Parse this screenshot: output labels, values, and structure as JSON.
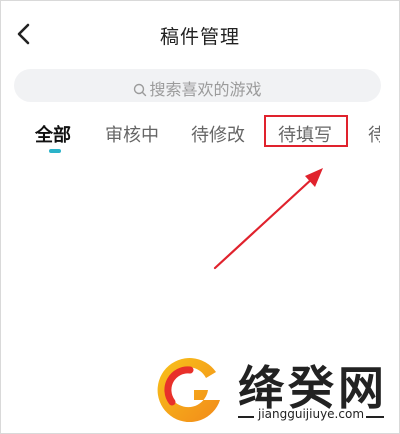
{
  "header": {
    "title": "稿件管理"
  },
  "search": {
    "placeholder": "搜索喜欢的游戏"
  },
  "tabs": [
    {
      "label": "全部",
      "active": true
    },
    {
      "label": "审核中",
      "active": false
    },
    {
      "label": "待修改",
      "active": false
    },
    {
      "label": "待填写",
      "active": false,
      "highlighted": true
    },
    {
      "label": "待",
      "active": false,
      "partial": true
    }
  ],
  "colors": {
    "tab_indicator": "#2bb3c9",
    "highlight": "#e0222d",
    "search_bg": "#f1f2f4"
  },
  "watermark": {
    "brand": "绛癸网",
    "url": "jiangguijiuye.com"
  }
}
